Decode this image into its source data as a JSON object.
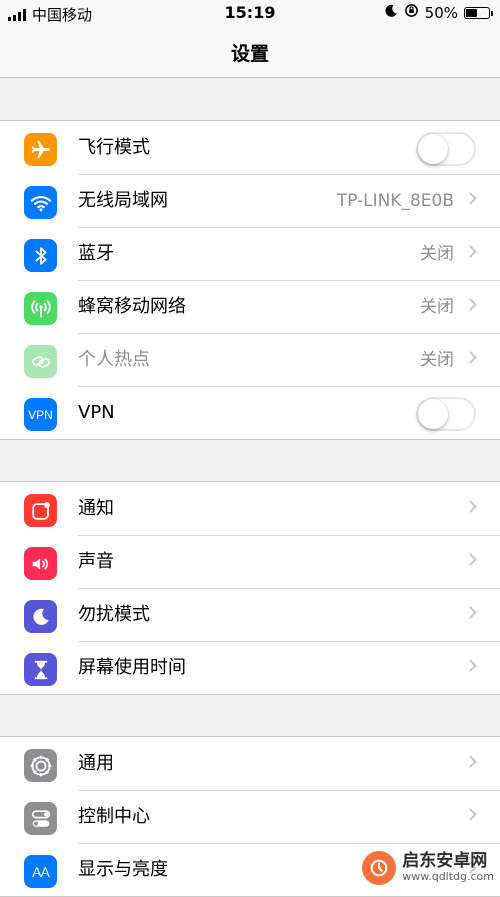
{
  "status_bar": {
    "carrier": "中国移动",
    "time": "15:19",
    "battery_text": "50%",
    "battery_level": 0.5,
    "icons": [
      "signal-icon",
      "moon-icon",
      "orientation-lock-icon",
      "battery-icon"
    ]
  },
  "nav": {
    "title": "设置"
  },
  "groups": [
    {
      "rows": [
        {
          "label": "飞行模式",
          "icon": "airplane-icon",
          "color": "#ff9500",
          "control": "toggle",
          "on": false
        },
        {
          "label": "无线局域网",
          "icon": "wifi-icon",
          "color": "#007aff",
          "value": "TP-LINK_8E0B",
          "control": "chevron"
        },
        {
          "label": "蓝牙",
          "icon": "bluetooth-icon",
          "color": "#007aff",
          "value": "关闭",
          "control": "chevron"
        },
        {
          "label": "蜂窝移动网络",
          "icon": "cellular-icon",
          "color": "#4cd964",
          "value": "关闭",
          "control": "chevron"
        },
        {
          "label": "个人热点",
          "icon": "hotspot-icon",
          "color": "#a8e6b4",
          "value": "关闭",
          "control": "chevron",
          "disabled": true
        },
        {
          "label": "VPN",
          "icon": "vpn-icon",
          "icon_text": "VPN",
          "color": "#007aff",
          "control": "toggle",
          "on": false
        }
      ]
    },
    {
      "rows": [
        {
          "label": "通知",
          "icon": "notifications-icon",
          "color": "#ff3b30",
          "control": "chevron"
        },
        {
          "label": "声音",
          "icon": "sound-icon",
          "color": "#ff2d55",
          "control": "chevron"
        },
        {
          "label": "勿扰模式",
          "icon": "moon-icon",
          "color": "#5856d6",
          "control": "chevron"
        },
        {
          "label": "屏幕使用时间",
          "icon": "hourglass-icon",
          "color": "#5856d6",
          "control": "chevron"
        }
      ]
    },
    {
      "rows": [
        {
          "label": "通用",
          "icon": "gear-icon",
          "color": "#8e8e93",
          "control": "chevron"
        },
        {
          "label": "控制中心",
          "icon": "control-center-icon",
          "color": "#8e8e93",
          "control": "chevron"
        },
        {
          "label": "显示与亮度",
          "icon": "display-brightness-icon",
          "icon_text": "AA",
          "color": "#007aff",
          "control": "chevron"
        }
      ]
    }
  ],
  "watermark": {
    "line1": "启东安卓网",
    "line2": "www.qdltdg.com",
    "color": "#f2652a"
  }
}
